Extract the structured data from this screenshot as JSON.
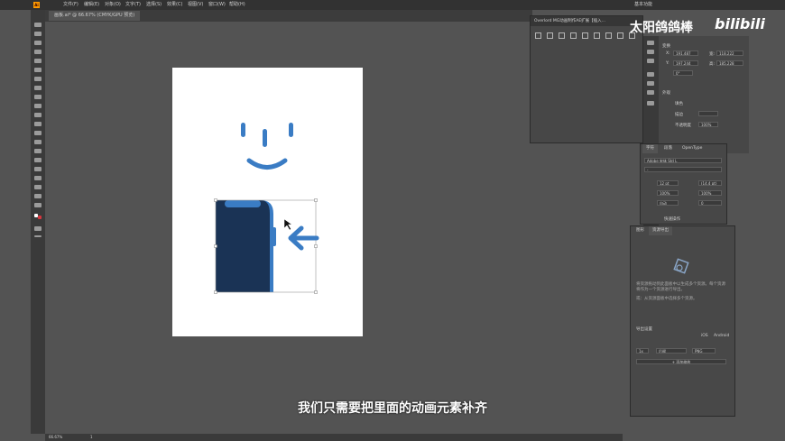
{
  "app": {
    "logo": "Ai"
  },
  "menu": [
    "文件(F)",
    "编辑(E)",
    "对象(O)",
    "文字(T)",
    "选择(S)",
    "效果(C)",
    "视图(V)",
    "窗口(W)",
    "帮助(H)"
  ],
  "workspace_label": "基本功能",
  "document_tab": "画板.ai* @ 66.67% (CMYK/GPU 预览)",
  "overlord_title": "Overlord  MG动画制作AE扩展【插入...",
  "watermark": {
    "text": "太阳鸽鸽棒",
    "brand": "bilibili"
  },
  "properties": {
    "title": "变换",
    "x_label": "X:",
    "x": "191.487",
    "w_label": "宽:",
    "w": "118.222",
    "y_label": "Y:",
    "y": "197.244",
    "h_label": "高:",
    "h": "185.228",
    "angle": "0°",
    "appearance_title": "外观",
    "fill": "填色",
    "stroke": "描边",
    "opacity_label": "不透明度",
    "opacity": "100%",
    "quick_actions": "快速操作"
  },
  "character_panel": {
    "tabs": [
      "字符",
      "段落",
      "OpenType"
    ],
    "font": "Adobe 宋体 Std L",
    "style": "-",
    "size": "12 pt",
    "leading": "(14.4 pt)",
    "scale_v": "100%",
    "scale_h": "100%",
    "kerning": "自动",
    "tracking": "0"
  },
  "asset_panel": {
    "tabs": [
      "图形",
      "资源导出"
    ],
    "hint": "将资源拖动到此面板中以生成多个资源。每个资源将作为一个资源进行导出。",
    "hint2": "或：从资源面板中选择多个资源。",
    "export_settings": "导出设置",
    "ios": "iOS",
    "android": "Android",
    "scale": "1x",
    "suffix": "后缀",
    "format": "PNG",
    "add_scale": "+ 添加缩放"
  },
  "status": {
    "zoom": "66.67%",
    "page": "1"
  },
  "subtitle": "我们只需要把里面的动画元素补齐",
  "colors": {
    "accent_blue": "#3a7cc4",
    "phone_dark": "#1a3355",
    "watermark": "#ffffff"
  },
  "icons": [
    "selection-icon",
    "direct-selection-icon",
    "pen-icon",
    "type-icon",
    "brush-icon",
    "arrow-left-icon"
  ]
}
